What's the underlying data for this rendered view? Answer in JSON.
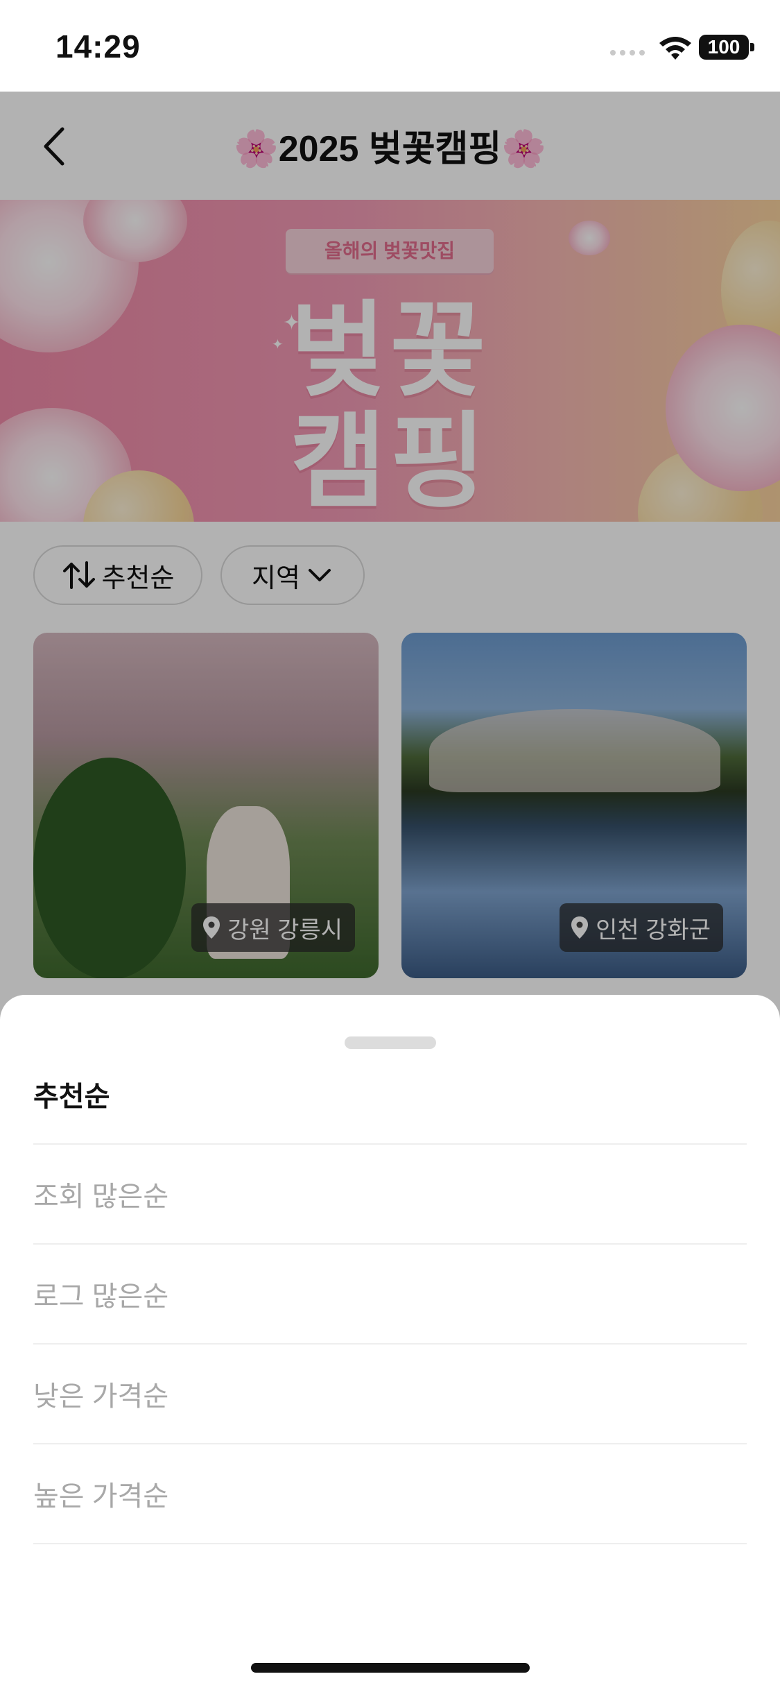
{
  "status_bar": {
    "time": "14:29",
    "battery": "100"
  },
  "header": {
    "title": "🌸2025 벚꽃캠핑🌸",
    "back_icon": "chevron-left-icon"
  },
  "banner": {
    "ribbon": "올해의 벚꽃맛집",
    "line1": "벚꽃",
    "line2": "캠핑"
  },
  "filters": {
    "sort_label": "추천순",
    "sort_icon": "sort-arrows-icon",
    "region_label": "지역",
    "region_icon": "chevron-down-icon"
  },
  "cards": [
    {
      "location": "강원 강릉시",
      "icon": "location-pin-icon"
    },
    {
      "location": "인천 강화군",
      "icon": "location-pin-icon"
    }
  ],
  "sort_sheet": {
    "options": [
      {
        "label": "추천순",
        "selected": true
      },
      {
        "label": "조회 많은순",
        "selected": false
      },
      {
        "label": "로그 많은순",
        "selected": false
      },
      {
        "label": "낮은 가격순",
        "selected": false
      },
      {
        "label": "높은 가격순",
        "selected": false
      }
    ]
  },
  "colors": {
    "dim_overlay": "#0000004D",
    "selected_text": "#111111",
    "unselected_text": "#A8A8A8"
  }
}
